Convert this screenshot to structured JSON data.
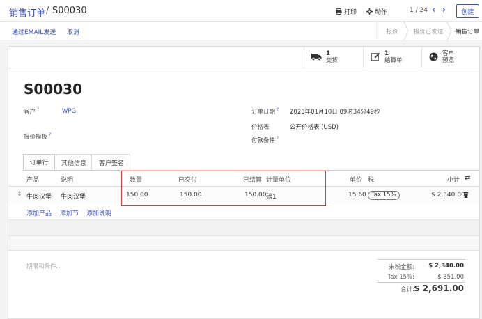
{
  "breadcrumb": {
    "parent": "销售订单",
    "separator": "/",
    "current": "S00030"
  },
  "actions": {
    "print": "打印",
    "action": "动作"
  },
  "pager": {
    "value": "1 / 24"
  },
  "create_label": "创建",
  "subbar": {
    "send_email": "通过EMAIL发送",
    "cancel": "取消"
  },
  "stages": [
    "报价",
    "报价已发送",
    "销售订单"
  ],
  "stat_buttons": [
    {
      "num": "1",
      "label": "交货",
      "icon": "truck-icon"
    },
    {
      "num": "1",
      "label": "结算单",
      "icon": "invoice-icon"
    },
    {
      "num": "客户",
      "label": "预览",
      "icon": "globe-icon"
    }
  ],
  "record": {
    "name": "S00030",
    "customer_label": "客户",
    "customer_value": "WPG",
    "template_label": "报价模板",
    "order_date_label": "订单日期",
    "order_date_value": "2023年01月10日 09时34分49秒",
    "pricelist_label": "价格表",
    "pricelist_value": "公开价格表 (USD)",
    "payment_terms_label": "付款条件",
    "help_mark": "?"
  },
  "tabs": [
    "订单行",
    "其他信息",
    "客户签名"
  ],
  "table": {
    "headers": {
      "product": "产品",
      "description": "说明",
      "quantity": "数量",
      "delivered": "已交付",
      "invoiced": "已结算",
      "uom": "计量单位",
      "unit_price": "单价",
      "taxes": "税",
      "subtotal": "小计"
    },
    "rows": [
      {
        "product": "牛肉汉堡",
        "description": "牛肉汉堡",
        "quantity": "150.00",
        "delivered": "150.00",
        "invoiced": "150.00",
        "uom": "磅1",
        "unit_price": "15.60",
        "tax": "Tax 15%",
        "subtotal": "$ 2,340.00"
      }
    ],
    "add_product": "添加产品",
    "add_section": "添加节",
    "add_note": "添加说明"
  },
  "terms_placeholder": "期限和条件...",
  "totals": {
    "untaxed_label": "未税金额:",
    "untaxed_value": "$ 2,340.00",
    "tax_label": "Tax 15%:",
    "tax_value": "$ 351.00",
    "total_label": "合计:",
    "total_value": "$ 2,691.00"
  },
  "colors": {
    "primary": "#3f51b5",
    "highlight_box": "#e53935"
  }
}
